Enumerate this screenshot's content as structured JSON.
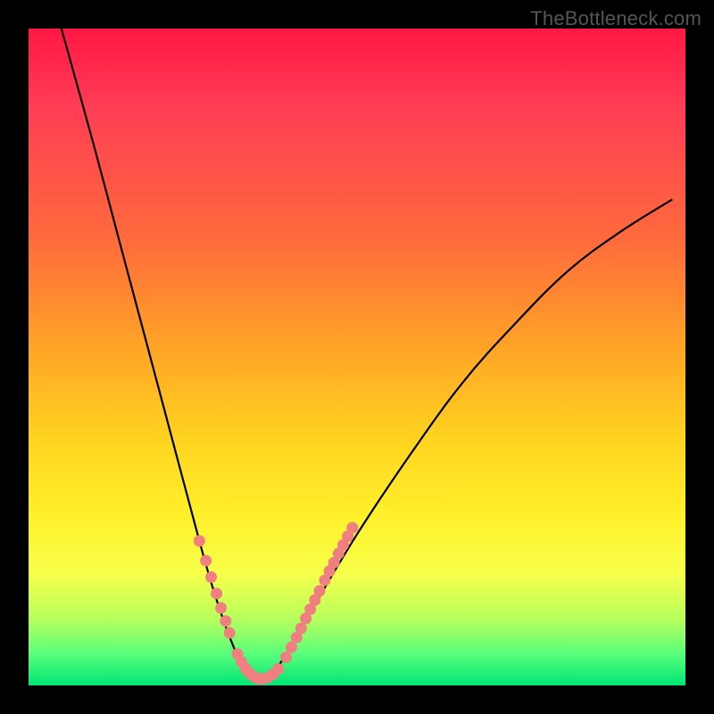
{
  "watermark": {
    "text": "TheBottleneck.com"
  },
  "colors": {
    "curve_stroke": "#000000",
    "dot_fill": "#f08080",
    "background": "#000000"
  },
  "chart_data": {
    "type": "line",
    "title": "",
    "xlabel": "",
    "ylabel": "",
    "xlim": [
      0,
      100
    ],
    "ylim": [
      0,
      100
    ],
    "grid": false,
    "legend": false,
    "series": [
      {
        "name": "bottleneck-curve",
        "x": [
          5,
          10,
          14,
          18,
          22,
          26,
          28,
          30,
          32,
          33,
          34,
          36,
          38,
          40,
          44,
          50,
          58,
          66,
          74,
          82,
          90,
          98
        ],
        "values": [
          100,
          82,
          67,
          52,
          37,
          22,
          15,
          9,
          4,
          2,
          1,
          1,
          3,
          6,
          13,
          23,
          35,
          46,
          55,
          63,
          69,
          74
        ]
      }
    ],
    "scatter_overlay": {
      "name": "highlight-dots",
      "points": [
        {
          "x": 26.0,
          "y": 22.0
        },
        {
          "x": 27.0,
          "y": 19.0
        },
        {
          "x": 27.8,
          "y": 16.5
        },
        {
          "x": 28.6,
          "y": 14.0
        },
        {
          "x": 29.3,
          "y": 11.8
        },
        {
          "x": 30.0,
          "y": 9.8
        },
        {
          "x": 30.6,
          "y": 8.0
        },
        {
          "x": 31.8,
          "y": 4.8
        },
        {
          "x": 32.4,
          "y": 3.6
        },
        {
          "x": 33.0,
          "y": 2.6
        },
        {
          "x": 33.6,
          "y": 1.9
        },
        {
          "x": 34.2,
          "y": 1.4
        },
        {
          "x": 34.9,
          "y": 1.0
        },
        {
          "x": 35.6,
          "y": 1.0
        },
        {
          "x": 36.4,
          "y": 1.2
        },
        {
          "x": 37.2,
          "y": 1.7
        },
        {
          "x": 38.0,
          "y": 2.5
        },
        {
          "x": 39.2,
          "y": 4.3
        },
        {
          "x": 40.0,
          "y": 5.8
        },
        {
          "x": 40.8,
          "y": 7.3
        },
        {
          "x": 41.5,
          "y": 8.7
        },
        {
          "x": 42.2,
          "y": 10.2
        },
        {
          "x": 42.9,
          "y": 11.6
        },
        {
          "x": 43.6,
          "y": 13.0
        },
        {
          "x": 44.3,
          "y": 14.4
        },
        {
          "x": 45.1,
          "y": 16.0
        },
        {
          "x": 45.8,
          "y": 17.4
        },
        {
          "x": 46.5,
          "y": 18.7
        },
        {
          "x": 47.2,
          "y": 20.1
        },
        {
          "x": 47.9,
          "y": 21.4
        },
        {
          "x": 48.6,
          "y": 22.7
        },
        {
          "x": 49.3,
          "y": 24.0
        }
      ]
    }
  }
}
